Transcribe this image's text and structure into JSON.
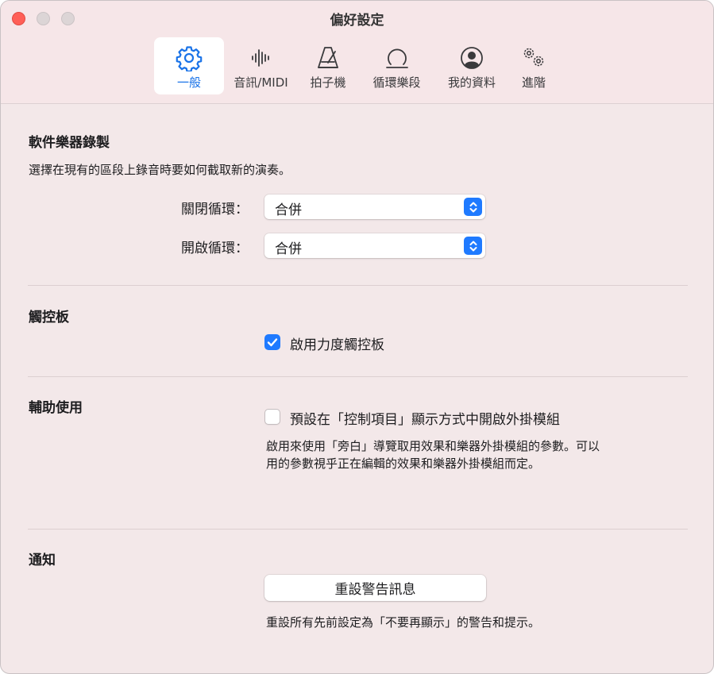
{
  "window": {
    "title": "偏好設定"
  },
  "tabs": [
    {
      "label": "一般",
      "icon": "gear-icon",
      "active": true
    },
    {
      "label": "音訊/MIDI",
      "icon": "waveform-icon",
      "active": false
    },
    {
      "label": "拍子機",
      "icon": "metronome-icon",
      "active": false
    },
    {
      "label": "循環樂段",
      "icon": "loop-icon",
      "active": false
    },
    {
      "label": "我的資料",
      "icon": "person-circle-icon",
      "active": false
    },
    {
      "label": "進階",
      "icon": "gears-icon",
      "active": false
    }
  ],
  "recording": {
    "title": "軟件樂器錄製",
    "description": "選擇在現有的區段上錄音時要如何截取新的演奏。",
    "cycle_off_label": "關閉循環：",
    "cycle_off_value": "合併",
    "cycle_on_label": "開啟循環：",
    "cycle_on_value": "合併"
  },
  "touchpad": {
    "title": "觸控板",
    "force_touch_label": "啟用力度觸控板",
    "force_touch_checked": true
  },
  "accessibility": {
    "title": "輔助使用",
    "plugin_controls_label": "預設在「控制項目」顯示方式中開啟外掛模組",
    "plugin_controls_checked": false,
    "help_line1": "啟用來使用「旁白」導覽取用效果和樂器外掛模組的參數。可以",
    "help_line2": "用的參數視乎正在編輯的效果和樂器外掛模組而定。"
  },
  "notifications": {
    "title": "通知",
    "reset_button": "重設警告訊息",
    "help": "重設所有先前設定為「不要再顯示」的警告和提示。"
  },
  "colors": {
    "accent": "#1f7aff",
    "active_tab_text": "#1a73e8",
    "window_bg": "#f3e8e9",
    "close_button": "#ff5f57"
  }
}
